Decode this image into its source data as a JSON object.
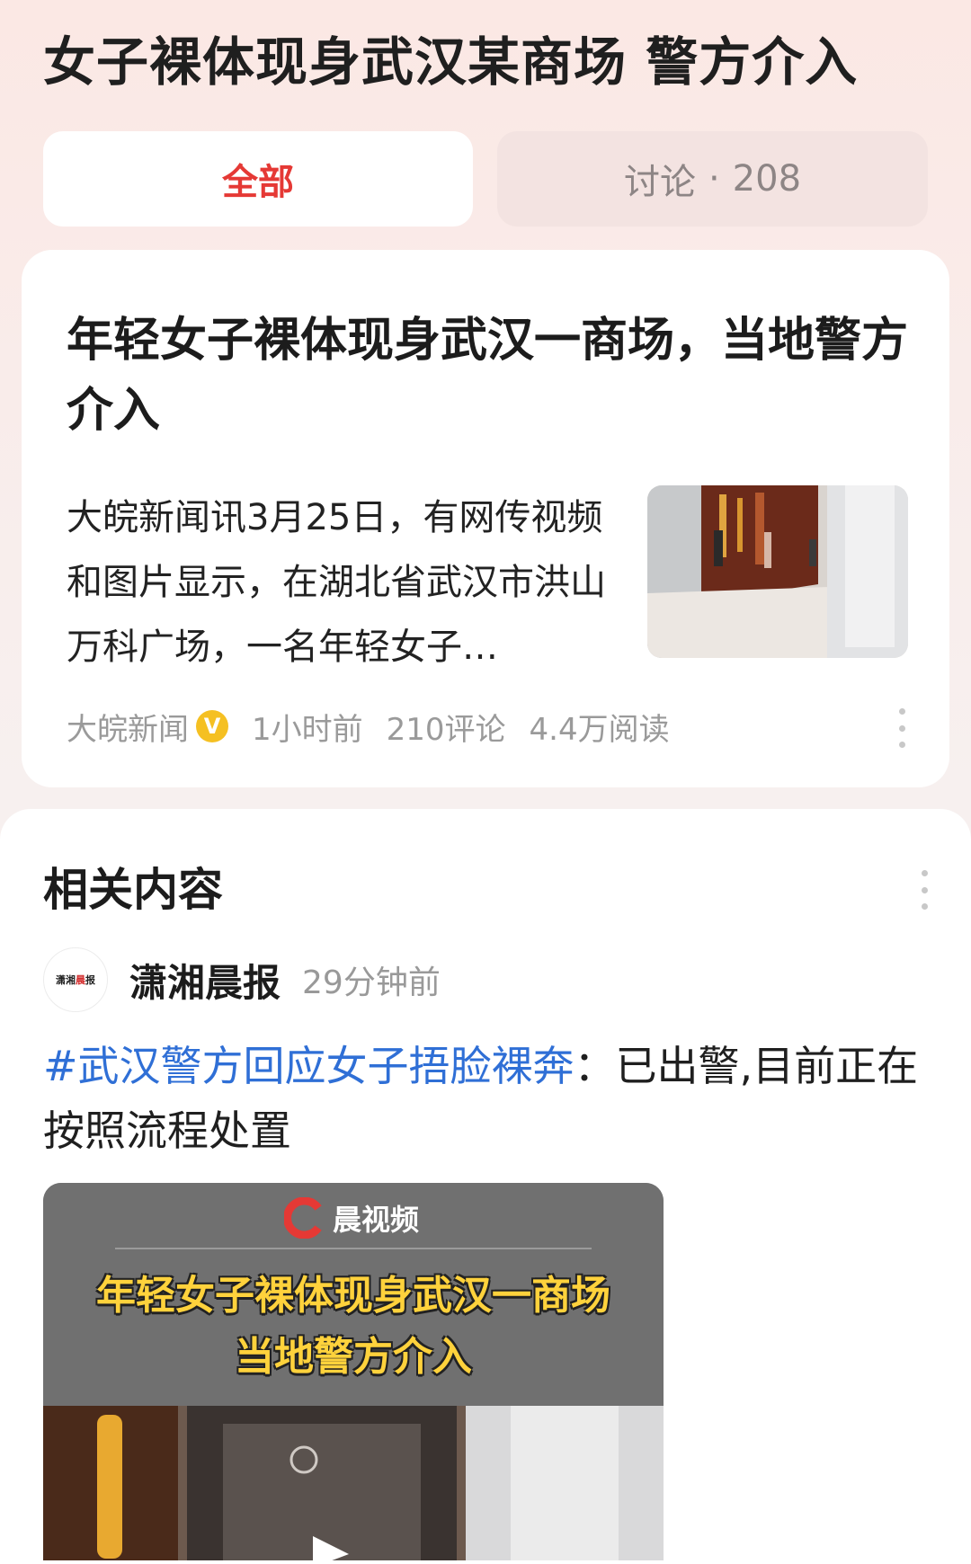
{
  "topic": {
    "title": "女子裸体现身武汉某商场 警方介入"
  },
  "tabs": {
    "all_label": "全部",
    "discuss_label": "讨论",
    "discuss_sep": "·",
    "discuss_count": "208"
  },
  "article": {
    "title": "年轻女子裸体现身武汉一商场，当地警方介入",
    "summary": "大皖新闻讯3月25日，有网传视频和图片显示，在湖北省武汉市洪山万科广场，一名年轻女子…",
    "source": "大皖新闻",
    "verified_badge": "V",
    "time": "1小时前",
    "comments": "210评论",
    "reads": "4.4万阅读"
  },
  "related": {
    "title": "相关内容",
    "source_logo_text_a": "潇湘",
    "source_logo_text_b": "晨",
    "source_logo_text_c": "报",
    "source_name": "潇湘晨报",
    "time": "29分钟前",
    "hashtag": "#武汉警方回应女子捂脸裸奔",
    "colon": "：",
    "text": "已出警,目前正在按照流程处置",
    "video": {
      "brand": "晨视频",
      "caption_line1": "年轻女子裸体现身武汉一商场",
      "caption_line2": "当地警方介入"
    }
  },
  "colors": {
    "accent_red": "#e53935",
    "hashtag_blue": "#2f6fd6",
    "verified_gold": "#f5c022",
    "caption_yellow": "#ffd23c"
  },
  "icons": [
    "verified-badge-icon",
    "more-options-icon",
    "brand-logo-icon"
  ]
}
